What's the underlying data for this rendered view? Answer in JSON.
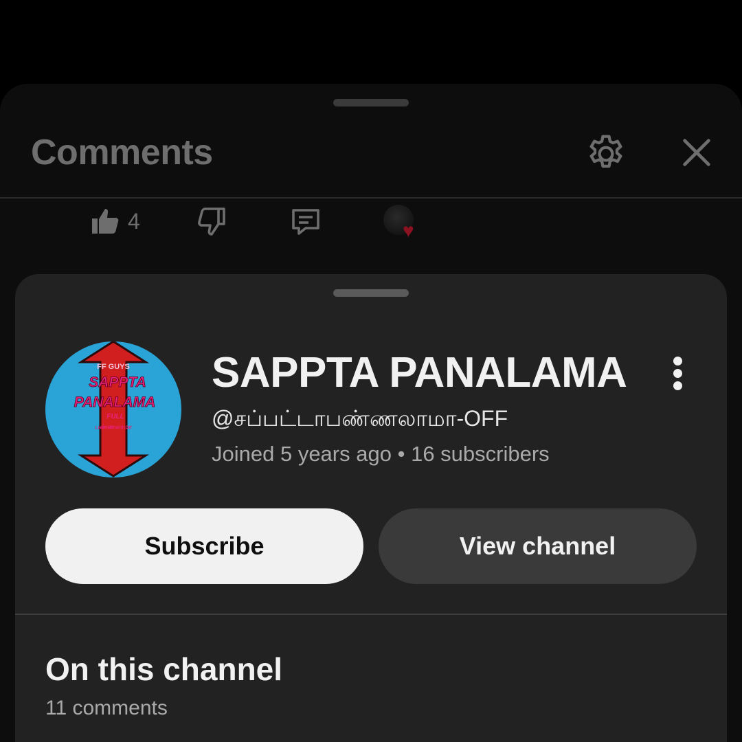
{
  "comments_panel": {
    "title": "Comments",
    "like_count": "4",
    "icons": {
      "settings": "gear-icon",
      "close": "close-icon",
      "like": "thumbs-up-icon",
      "dislike": "thumbs-down-icon",
      "reply": "reply-icon",
      "creator_heart": "heart-icon"
    }
  },
  "channel_card": {
    "name": "SAPPTA PANALAMA",
    "handle": "@சப்பட்டாபண்ணலாமா-OFF",
    "joined": "Joined 5 years ago",
    "separator": "•",
    "subscribers": "16 subscribers",
    "subscribe_label": "Subscribe",
    "view_channel_label": "View channel",
    "logo": {
      "top_text": "FF GUYS",
      "line1": "SAPPTA",
      "line2": "PANALAMA",
      "line3": "FULL",
      "line4": "பண்ணலாமா"
    }
  },
  "on_this_channel": {
    "title": "On this channel",
    "count": "11 comments"
  },
  "colors": {
    "background": "#000000",
    "sheet": "#222222",
    "subscribe_bg": "#f1f1f1",
    "view_channel_bg": "#3a3a3a",
    "logo_bg": "#2aa3d6",
    "logo_arrow": "#d11f1f",
    "logo_text": "#e8207a"
  }
}
